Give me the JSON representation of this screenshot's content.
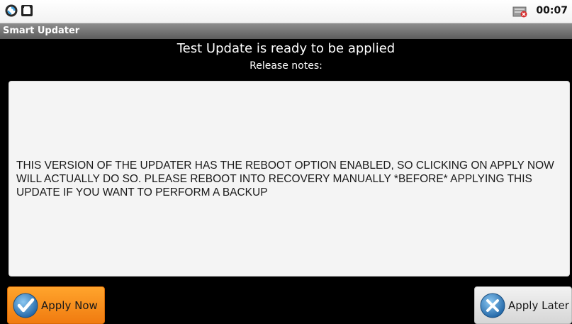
{
  "status_bar": {
    "time": "00:07",
    "left_icons": [
      "sync-icon",
      "android-icon"
    ],
    "right_icons": [
      "notification-error-icon"
    ]
  },
  "title_bar": {
    "title": "Smart Updater"
  },
  "main": {
    "headline": "Test Update is ready to be applied",
    "subheadline": "Release notes:",
    "release_notes": "THIS VERSION OF THE UPDATER HAS THE REBOOT OPTION ENABLED, SO CLICKING ON APPLY NOW WILL ACTUALLY DO SO. PLEASE REBOOT INTO RECOVERY MANUALLY *BEFORE* APPLYING THIS UPDATE IF YOU WANT TO PERFORM A BACKUP"
  },
  "buttons": {
    "apply_now": {
      "label": "Apply Now",
      "icon": "checkmark-icon",
      "color": "#f58d1a"
    },
    "apply_later": {
      "label": "Apply Later",
      "icon": "cancel-x-icon",
      "color": "#e4e4e4"
    }
  },
  "colors": {
    "background": "#000000",
    "notes_background": "#f4f4f4",
    "title_bar": "#6f6f6f",
    "accent_orange": "#f58d1a",
    "icon_blue": "#2f86c8"
  }
}
